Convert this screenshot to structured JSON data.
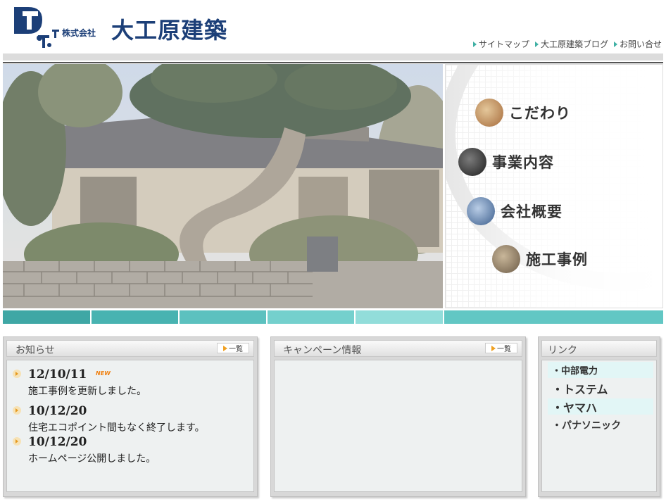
{
  "header": {
    "logo_letters": "DT",
    "company_type": "株式会社",
    "company_name": "大工原建築",
    "util_nav": [
      {
        "label": "サイトマップ"
      },
      {
        "label": "大工原建築ブログ"
      },
      {
        "label": "お問い合せ"
      }
    ]
  },
  "side_menu": [
    {
      "label": "こだわり",
      "icon": "craft-photo-icon"
    },
    {
      "label": "事業内容",
      "icon": "tools-photo-icon"
    },
    {
      "label": "会社概要",
      "icon": "building-photo-icon"
    },
    {
      "label": "施工事例",
      "icon": "house-photo-icon"
    }
  ],
  "colors": {
    "brand": "#1c3f78",
    "teal": [
      "#3fa7a5",
      "#48b3b1",
      "#5cc1bf",
      "#74d0cd",
      "#92ddda",
      "#62c7c4"
    ],
    "accent_orange": "#f08010"
  },
  "panels": {
    "news": {
      "title": "お知らせ",
      "more": "一覧",
      "items": [
        {
          "date": "12/10/11",
          "badge": "NEW",
          "text": "施工事例を更新しました。"
        },
        {
          "date": "10/12/20",
          "badge": "",
          "text": "住宅エコポイント間もなく終了します。"
        },
        {
          "date": "10/12/20",
          "badge": "",
          "text": "ホームページ公開しました。"
        }
      ]
    },
    "campaign": {
      "title": "キャンペーン情報",
      "more": "一覧"
    },
    "links": {
      "title": "リンク",
      "items": [
        {
          "label": "・中部電力"
        },
        {
          "label": "・トステム"
        },
        {
          "label": "・ヤマハ"
        },
        {
          "label": "・パナソニック"
        }
      ]
    }
  }
}
